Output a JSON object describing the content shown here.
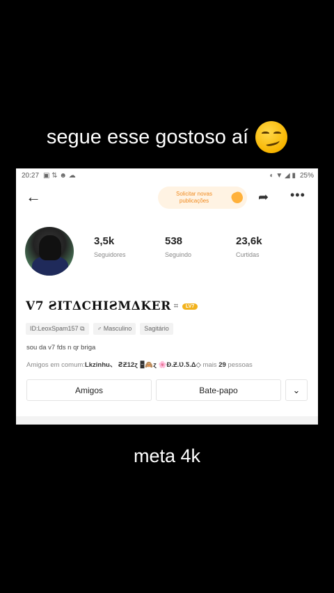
{
  "captions": {
    "top": "segue esse gostoso aí",
    "bottom": "meta 4k"
  },
  "statusbar": {
    "time": "20:27",
    "battery": "25%"
  },
  "header": {
    "request_label_line1": "Solicitar novas",
    "request_label_line2": "publicações"
  },
  "stats": [
    {
      "value": "3,5k",
      "label": "Seguidores"
    },
    {
      "value": "538",
      "label": "Seguindo"
    },
    {
      "value": "23,6k",
      "label": "Curtidas"
    }
  ],
  "profile": {
    "name": "V7  ꙄITΔCHIꙄMΔKER",
    "level": "LV7",
    "id_tag": "ID:LeoxSpam157",
    "gender_tag": "♂ Masculino",
    "sign_tag": "Sagitário",
    "bio": "sou da v7 fds n qr briga",
    "mutual_prefix": "Amigos em comum:",
    "mutual_names": "Lkzinhu、 ꙄƵ12ɀ 🁢🙈ɀ 🌸Ð.Ƶ.Ʋ.Ƽ.Δ◇",
    "mutual_mid": " mais ",
    "mutual_count": "29",
    "mutual_suffix": " pessoas"
  },
  "buttons": {
    "friends": "Amigos",
    "chat": "Bate-papo"
  }
}
